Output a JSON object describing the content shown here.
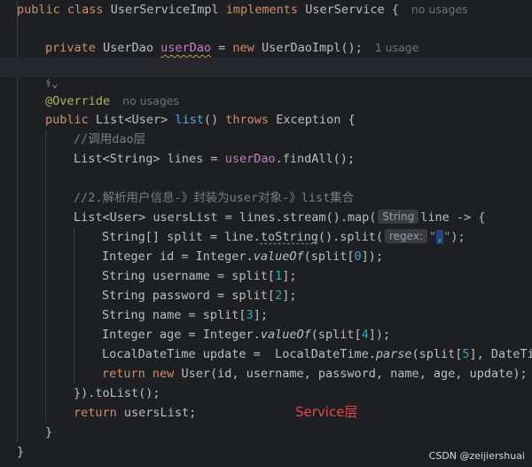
{
  "code": {
    "l1": {
      "kw1": "public",
      "kw2": "class",
      "cls": "UserServiceImpl",
      "kw3": "implements",
      "iface": "UserService",
      "brace": "{",
      "hint": "no usages"
    },
    "l2": {
      "kw1": "private",
      "type": "UserDao",
      "field": "userDao",
      "eq": "=",
      "kw2": "new",
      "ctor": "UserDaoImpl();",
      "hint": "1 usage"
    },
    "l4": {
      "icon": "⚕⌄"
    },
    "l5": {
      "ann": "@Override",
      "hint": "no usages"
    },
    "l6": {
      "kw1": "public",
      "ret": "List<User>",
      "fn": "list",
      "parens": "()",
      "kw2": "throws",
      "exc": "Exception {"
    },
    "l7": {
      "comment": "//调用dao层"
    },
    "l8": {
      "type": "List<String> lines =",
      "field": "userDao",
      "rest": ".findAll();"
    },
    "l10": {
      "comment": "//2.解析用户信息-》封装为user对象-》list集合"
    },
    "l11": {
      "pre": "List<User> usersList = lines.stream().map(",
      "inlay": "String",
      "post": "line -> {"
    },
    "l12": {
      "pre": "String[] split = line.",
      "call": "toString",
      "mid": "().split(",
      "inlay": "regex:",
      "q1": "\"",
      "sep": ",",
      "q2": "\"",
      "end": ");"
    },
    "l13": {
      "pre": "Integer id = Integer.",
      "call": "valueOf",
      "mid": "(split[",
      "num": "0",
      "end": "]);"
    },
    "l14": {
      "pre": "String username = split[",
      "num": "1",
      "end": "];"
    },
    "l15": {
      "pre": "String password = split[",
      "num": "2",
      "end": "];"
    },
    "l16": {
      "pre": "String name = split[",
      "num": "3",
      "end": "];"
    },
    "l17": {
      "pre": "Integer age = Integer.",
      "call": "valueOf",
      "mid": "(split[",
      "num": "4",
      "end": "]);"
    },
    "l18": {
      "pre": "LocalDateTime update =  LocalDateTime.",
      "call": "parse",
      "mid": "(split[",
      "num": "5",
      "end": "], DateTim"
    },
    "l19": {
      "kw1": "return",
      "kw2": "new",
      "rest": "User(id, username, password, name, age, update);"
    },
    "l20": {
      "text": "}).toList();"
    },
    "l21": {
      "kw": "return",
      "rest": "usersList;"
    },
    "l22": {
      "text": "}"
    },
    "l23": {
      "text": "}"
    }
  },
  "overlay_label": "Service层",
  "watermark": "CSDN @zeijiershuai"
}
